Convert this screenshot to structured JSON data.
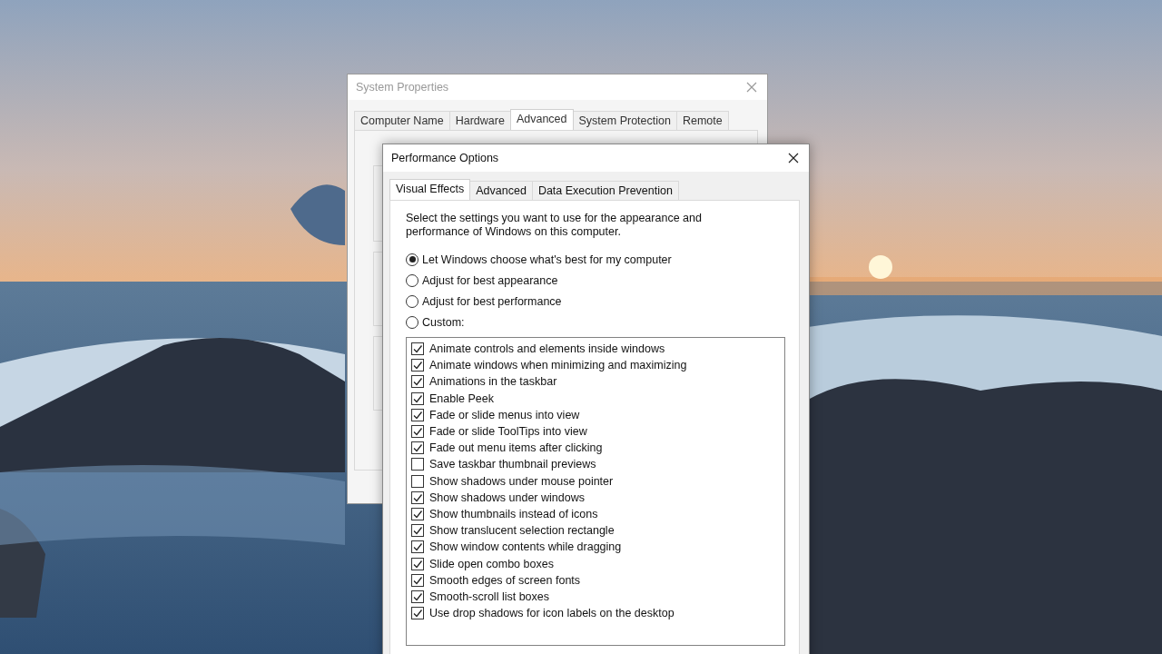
{
  "system_properties": {
    "title": "System Properties",
    "tabs": [
      {
        "label": "Computer Name",
        "selected": false
      },
      {
        "label": "Hardware",
        "selected": false
      },
      {
        "label": "Advanced",
        "selected": true
      },
      {
        "label": "System Protection",
        "selected": false
      },
      {
        "label": "Remote",
        "selected": false
      }
    ]
  },
  "performance_options": {
    "title": "Performance Options",
    "tabs": [
      {
        "label": "Visual Effects",
        "selected": true
      },
      {
        "label": "Advanced",
        "selected": false
      },
      {
        "label": "Data Execution Prevention",
        "selected": false
      }
    ],
    "description": "Select the settings you want to use for the appearance and performance of Windows on this computer.",
    "options": [
      {
        "label": "Let Windows choose what's best for my computer",
        "selected": true
      },
      {
        "label": "Adjust for best appearance",
        "selected": false
      },
      {
        "label": "Adjust for best performance",
        "selected": false
      },
      {
        "label": "Custom:",
        "selected": false
      }
    ],
    "effects": [
      {
        "label": "Animate controls and elements inside windows",
        "checked": true
      },
      {
        "label": "Animate windows when minimizing and maximizing",
        "checked": true
      },
      {
        "label": "Animations in the taskbar",
        "checked": true
      },
      {
        "label": "Enable Peek",
        "checked": true
      },
      {
        "label": "Fade or slide menus into view",
        "checked": true
      },
      {
        "label": "Fade or slide ToolTips into view",
        "checked": true
      },
      {
        "label": "Fade out menu items after clicking",
        "checked": true
      },
      {
        "label": "Save taskbar thumbnail previews",
        "checked": false
      },
      {
        "label": "Show shadows under mouse pointer",
        "checked": false
      },
      {
        "label": "Show shadows under windows",
        "checked": true
      },
      {
        "label": "Show thumbnails instead of icons",
        "checked": true
      },
      {
        "label": "Show translucent selection rectangle",
        "checked": true
      },
      {
        "label": "Show window contents while dragging",
        "checked": true
      },
      {
        "label": "Slide open combo boxes",
        "checked": true
      },
      {
        "label": "Smooth edges of screen fonts",
        "checked": true
      },
      {
        "label": "Smooth-scroll list boxes",
        "checked": true
      },
      {
        "label": "Use drop shadows for icon labels on the desktop",
        "checked": true
      }
    ]
  }
}
